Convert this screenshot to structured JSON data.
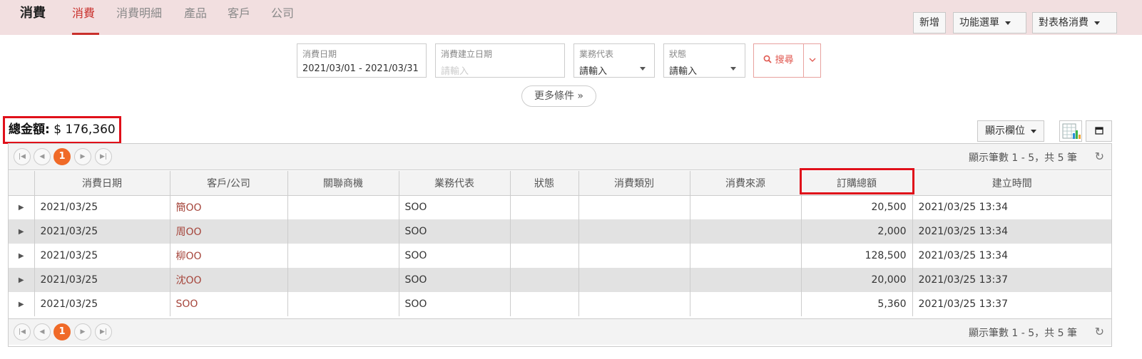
{
  "header": {
    "app_title": "消費",
    "tabs": [
      "消費",
      "消費明細",
      "產品",
      "客戶",
      "公司"
    ],
    "active_tab": 0,
    "buttons": {
      "add": "新增",
      "menu": "功能選單",
      "sheet": "對表格消費"
    }
  },
  "filters": {
    "date": {
      "label": "消費日期",
      "value": "2021/03/01 - 2021/03/31"
    },
    "created": {
      "label": "消費建立日期",
      "placeholder": "請輸入"
    },
    "rep": {
      "label": "業務代表",
      "value": "請輸入"
    },
    "status": {
      "label": "狀態",
      "value": "請輸入"
    },
    "search_label": "搜尋",
    "more_label": "更多條件 »"
  },
  "summary": {
    "total_label": "總金額:",
    "total_value": "$ 176,360"
  },
  "toolbar": {
    "columns_label": "顯示欄位"
  },
  "pager": {
    "current_page": "1",
    "info": "顯示筆數 1 - 5，共 5 筆"
  },
  "table": {
    "columns": [
      "消費日期",
      "客戶/公司",
      "關聯商機",
      "業務代表",
      "狀態",
      "消費類別",
      "消費來源",
      "訂購總額",
      "建立時間"
    ],
    "rows": [
      {
        "date": "2021/03/25",
        "customer": "簡OO",
        "opportunity": "",
        "rep": "SOO",
        "status": "",
        "category": "",
        "source": "",
        "total": "20,500",
        "created": "2021/03/25 13:34"
      },
      {
        "date": "2021/03/25",
        "customer": "周OO",
        "opportunity": "",
        "rep": "SOO",
        "status": "",
        "category": "",
        "source": "",
        "total": "2,000",
        "created": "2021/03/25 13:34"
      },
      {
        "date": "2021/03/25",
        "customer": "柳OO",
        "opportunity": "",
        "rep": "SOO",
        "status": "",
        "category": "",
        "source": "",
        "total": "128,500",
        "created": "2021/03/25 13:34"
      },
      {
        "date": "2021/03/25",
        "customer": "沈OO",
        "opportunity": "",
        "rep": "SOO",
        "status": "",
        "category": "",
        "source": "",
        "total": "20,000",
        "created": "2021/03/25 13:37"
      },
      {
        "date": "2021/03/25",
        "customer": "SOO",
        "opportunity": "",
        "rep": "SOO",
        "status": "",
        "category": "",
        "source": "",
        "total": "5,360",
        "created": "2021/03/25 13:37"
      }
    ]
  },
  "colors": {
    "accent": "#c9302c",
    "header_bg": "#f2dfe0",
    "page_active": "#f06a28",
    "highlight": "#e0101a"
  },
  "icons": {
    "search": "search-icon",
    "refresh": "refresh-icon",
    "expand": "expand-arrow-icon"
  }
}
